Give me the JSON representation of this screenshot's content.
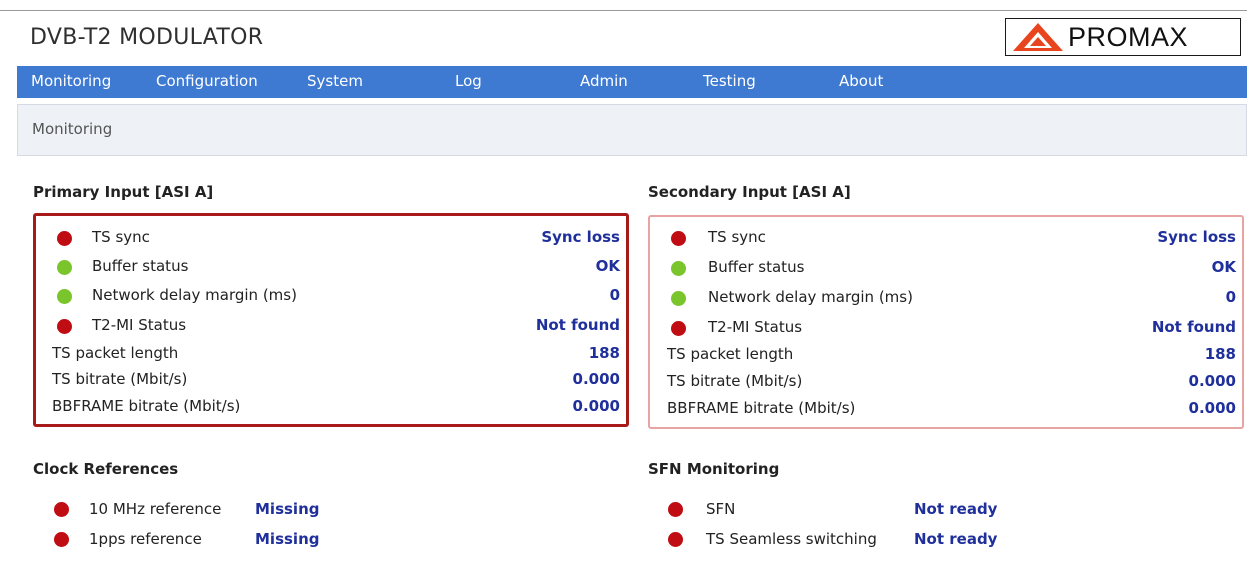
{
  "header": {
    "title": "DVB-T2 MODULATOR",
    "logo_text": "PROMAX",
    "logo_color": "#e8451e"
  },
  "nav": {
    "items": [
      {
        "label": "Monitoring"
      },
      {
        "label": "Configuration"
      },
      {
        "label": "System"
      },
      {
        "label": "Log"
      },
      {
        "label": "Admin"
      },
      {
        "label": "Testing"
      },
      {
        "label": "About"
      }
    ],
    "bg_color": "#3e7ad2"
  },
  "breadcrumb": "Monitoring",
  "primary": {
    "title": "Primary Input [ASI A]",
    "rows": [
      {
        "status": "red",
        "label": "TS sync",
        "value": "Sync loss"
      },
      {
        "status": "green",
        "label": "Buffer status",
        "value": "OK"
      },
      {
        "status": "green",
        "label": "Network delay margin (ms)",
        "value": "0"
      },
      {
        "status": "red",
        "label": "T2-MI Status",
        "value": "Not found"
      },
      {
        "status": "",
        "label": "TS packet length",
        "value": "188"
      },
      {
        "status": "",
        "label": "TS bitrate (Mbit/s)",
        "value": "0.000"
      },
      {
        "status": "",
        "label": "BBFRAME bitrate (Mbit/s)",
        "value": "0.000"
      }
    ]
  },
  "secondary": {
    "title": "Secondary Input [ASI A]",
    "rows": [
      {
        "status": "red",
        "label": "TS sync",
        "value": "Sync loss"
      },
      {
        "status": "green",
        "label": "Buffer status",
        "value": "OK"
      },
      {
        "status": "green",
        "label": "Network delay margin (ms)",
        "value": "0"
      },
      {
        "status": "red",
        "label": "T2-MI Status",
        "value": "Not found"
      },
      {
        "status": "",
        "label": "TS packet length",
        "value": "188"
      },
      {
        "status": "",
        "label": "TS bitrate (Mbit/s)",
        "value": "0.000"
      },
      {
        "status": "",
        "label": "BBFRAME bitrate (Mbit/s)",
        "value": "0.000"
      }
    ]
  },
  "clock": {
    "title": "Clock References",
    "rows": [
      {
        "status": "red",
        "label": "10 MHz reference",
        "value": "Missing"
      },
      {
        "status": "red",
        "label": "1pps reference",
        "value": "Missing"
      }
    ]
  },
  "sfn": {
    "title": "SFN Monitoring",
    "rows": [
      {
        "status": "red",
        "label": "SFN",
        "value": "Not ready"
      },
      {
        "status": "red",
        "label": "TS Seamless switching",
        "value": "Not ready"
      }
    ]
  }
}
